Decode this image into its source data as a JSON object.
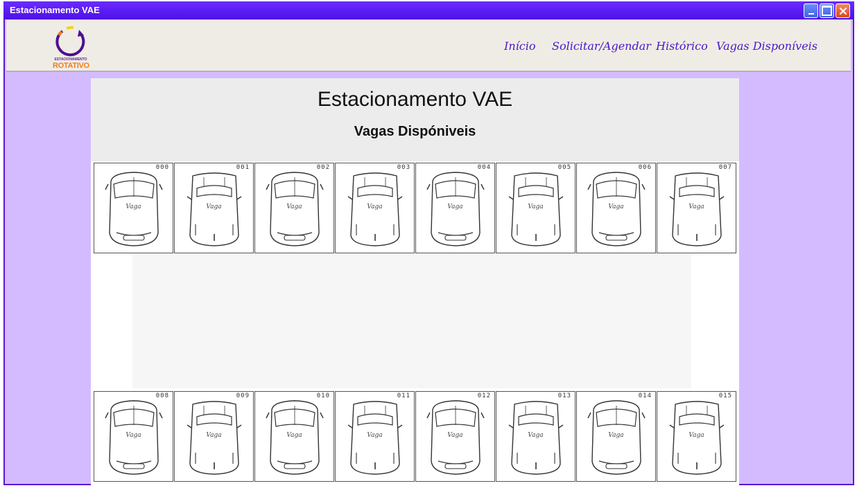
{
  "window": {
    "title": "Estacionamento VAE"
  },
  "logo": {
    "line1": "ESTACIONAMENTO",
    "line2": "ROTATIVO"
  },
  "nav": {
    "items": [
      {
        "label": "Início"
      },
      {
        "label": "Solicitar/Agendar"
      },
      {
        "label": "Histórico"
      },
      {
        "label": "Vagas Disponíveis"
      }
    ]
  },
  "page": {
    "title": "Estacionamento VAE",
    "subtitle": "Vagas Dispóniveis"
  },
  "spots_top": [
    {
      "number": "000",
      "label": "Vaga"
    },
    {
      "number": "001",
      "label": "Vaga"
    },
    {
      "number": "002",
      "label": "Vaga"
    },
    {
      "number": "003",
      "label": "Vaga"
    },
    {
      "number": "004",
      "label": "Vaga"
    },
    {
      "number": "005",
      "label": "Vaga"
    },
    {
      "number": "006",
      "label": "Vaga"
    },
    {
      "number": "007",
      "label": "Vaga"
    }
  ],
  "spots_bottom": [
    {
      "number": "008",
      "label": "Vaga"
    },
    {
      "number": "009",
      "label": "Vaga"
    },
    {
      "number": "010",
      "label": "Vaga"
    },
    {
      "number": "011",
      "label": "Vaga"
    },
    {
      "number": "012",
      "label": "Vaga"
    },
    {
      "number": "013",
      "label": "Vaga"
    },
    {
      "number": "014",
      "label": "Vaga"
    },
    {
      "number": "015",
      "label": "Vaga"
    }
  ],
  "colors": {
    "titlebar": "#5b1ef0",
    "window_bg": "#d4bbff",
    "nav_link": "#4a16c8",
    "logo_accent": "#f57b17"
  }
}
